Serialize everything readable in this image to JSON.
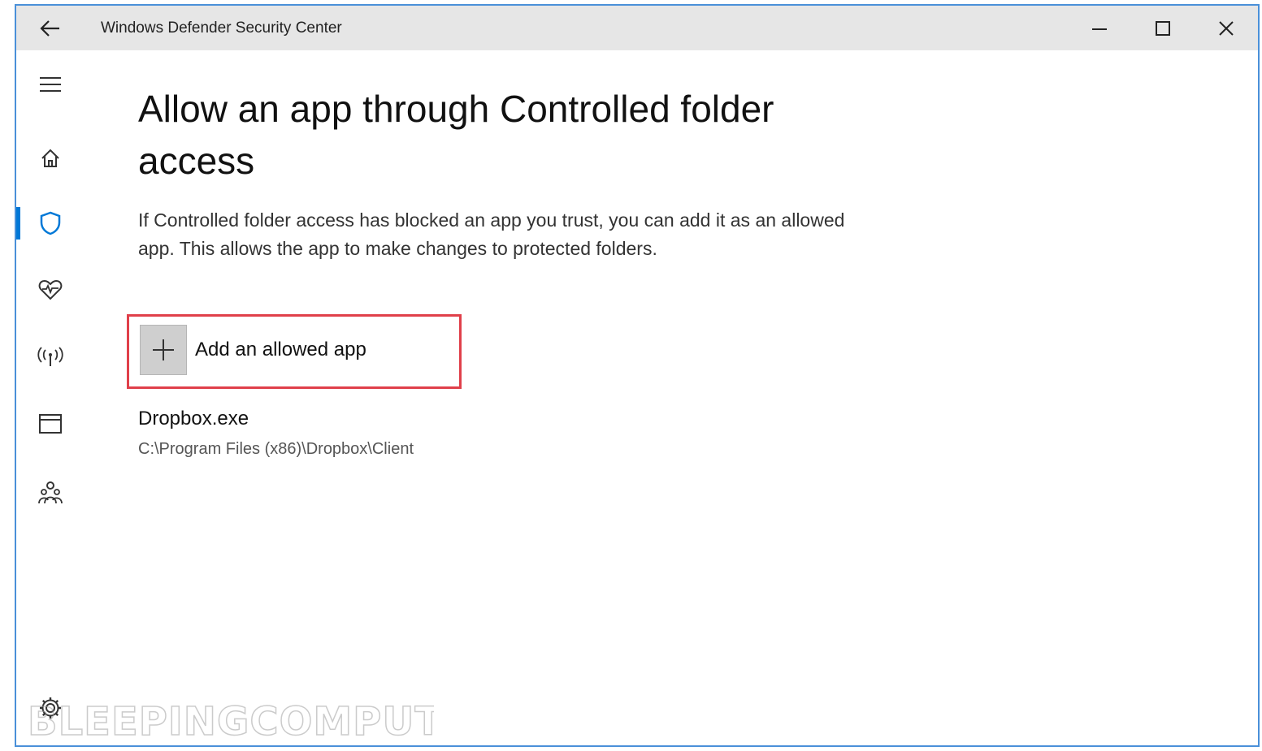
{
  "window": {
    "title": "Windows Defender Security Center",
    "accent_color": "#0078d7",
    "titlebar_color": "#e6e6e6"
  },
  "titlebar": {
    "back_icon": "back-arrow-icon",
    "controls": [
      "minimize-icon",
      "maximize-icon",
      "close-icon"
    ]
  },
  "sidebar": {
    "items": [
      {
        "icon": "hamburger-menu-icon"
      },
      {
        "icon": "home-icon"
      },
      {
        "icon": "shield-icon",
        "active": true
      },
      {
        "icon": "heart-health-icon"
      },
      {
        "icon": "network-antenna-icon"
      },
      {
        "icon": "app-browser-icon"
      },
      {
        "icon": "family-icon"
      },
      {
        "icon": "settings-gear-icon"
      }
    ]
  },
  "main": {
    "title": "Allow an app through Controlled folder access",
    "description": "If Controlled folder access has blocked an app you trust, you can add it as an allowed app. This allows the app to make changes to protected folders.",
    "add_button_label": "Add an allowed app",
    "highlight_color": "#e0404a",
    "allowed_apps": [
      {
        "name": "Dropbox.exe",
        "path": "C:\\Program Files (x86)\\Dropbox\\Client"
      }
    ]
  },
  "watermark": "BLEEPINGCOMPUTER"
}
